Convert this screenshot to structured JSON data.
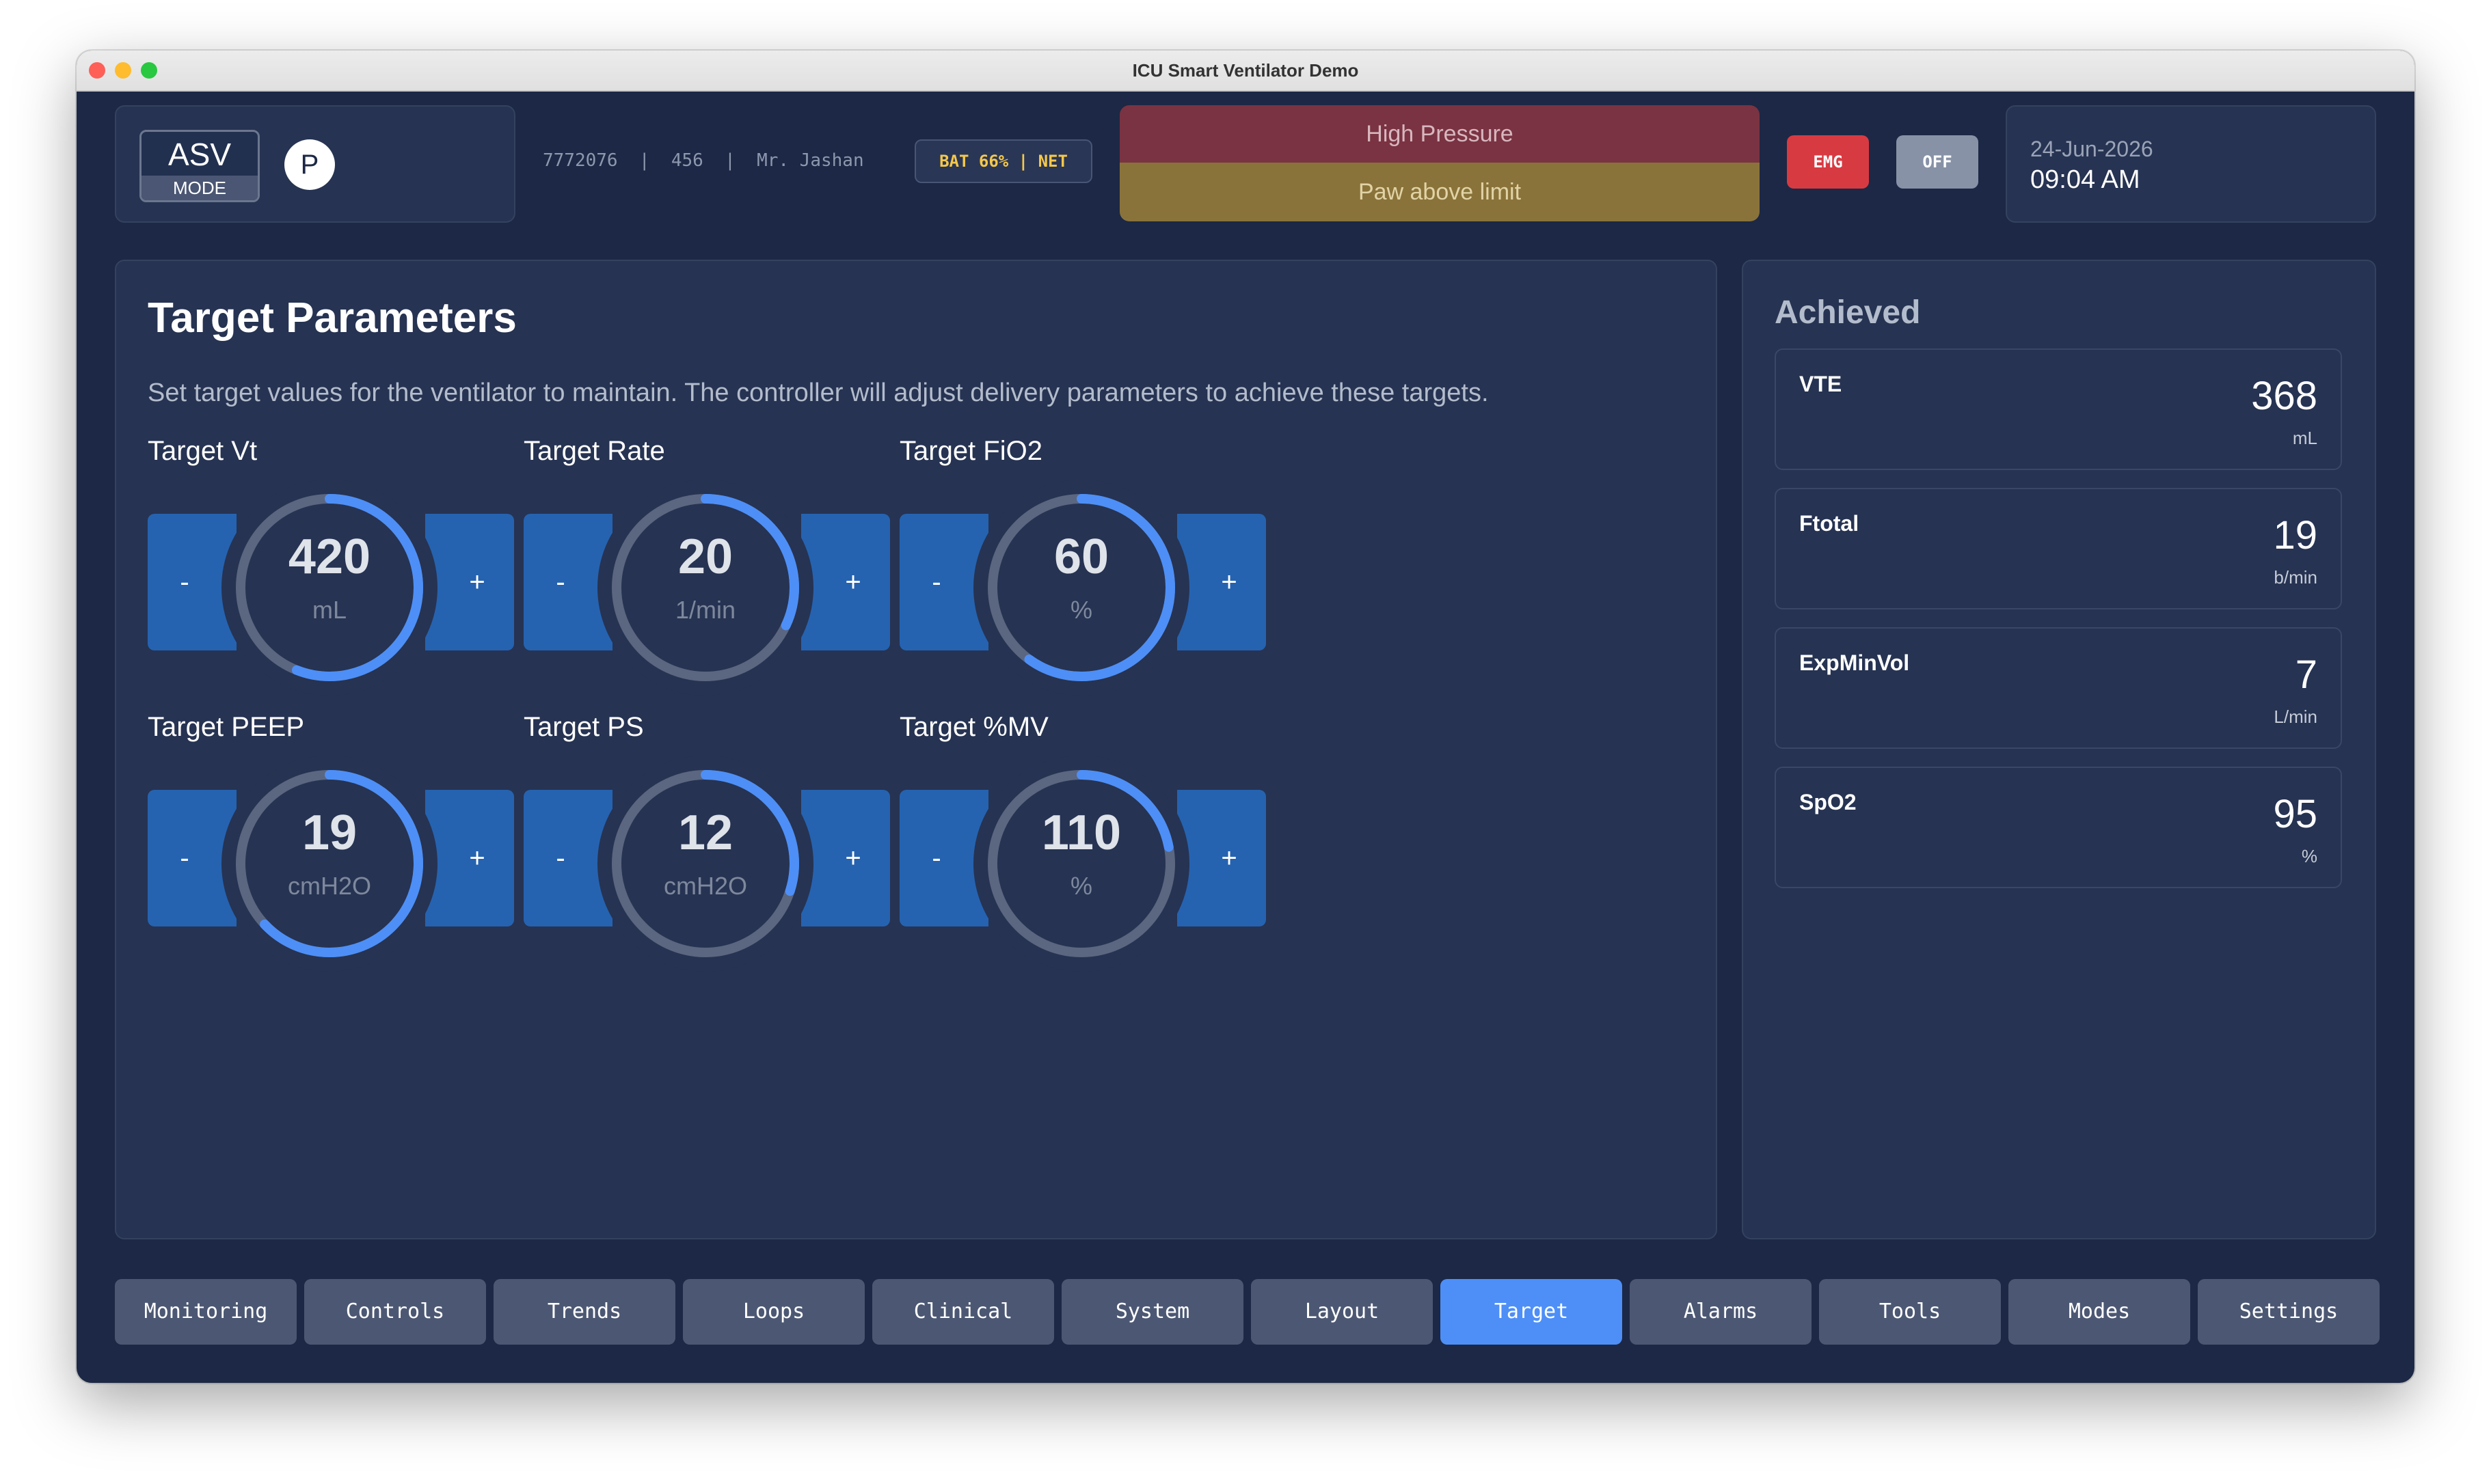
{
  "window": {
    "title": "ICU Smart Ventilator Demo"
  },
  "header": {
    "mode_value": "ASV",
    "mode_label": "MODE",
    "patient_badge": "P",
    "patient_info": "7772076  |  456  |  Mr. Jashan",
    "status": "BAT 66% | NET",
    "alarm_primary": "High Pressure",
    "alarm_secondary": "Paw above limit",
    "emg_label": "EMG",
    "off_label": "OFF",
    "date": "24-Jun-2026",
    "time": "09:04 AM"
  },
  "colors": {
    "accent": "#4d8ff7",
    "ring_track": "#5b6680",
    "stepper": "#2563b0",
    "alarm_high": "#7a3342",
    "alarm_medium": "#8a733a",
    "emg": "#d83a42"
  },
  "target": {
    "title": "Target Parameters",
    "description": "Set target values for the ventilator to maintain. The controller will adjust delivery parameters to achieve these targets.",
    "decrement_label": "-",
    "increment_label": "+",
    "controls": [
      {
        "label": "Target Vt",
        "value": "420",
        "unit": "mL",
        "fill": 0.56
      },
      {
        "label": "Target Rate",
        "value": "20",
        "unit": "1/min",
        "fill": 0.32
      },
      {
        "label": "Target FiO2",
        "value": "60",
        "unit": "%",
        "fill": 0.6
      },
      {
        "label": "Target PEEP",
        "value": "19",
        "unit": "cmH2O",
        "fill": 0.63
      },
      {
        "label": "Target PS",
        "value": "12",
        "unit": "cmH2O",
        "fill": 0.3
      },
      {
        "label": "Target %MV",
        "value": "110",
        "unit": "%",
        "fill": 0.22
      }
    ]
  },
  "achieved": {
    "title": "Achieved",
    "metrics": [
      {
        "name": "VTE",
        "value": "368",
        "unit": "mL"
      },
      {
        "name": "Ftotal",
        "value": "19",
        "unit": "b/min"
      },
      {
        "name": "ExpMinVol",
        "value": "7",
        "unit": "L/min"
      },
      {
        "name": "SpO2",
        "value": "95",
        "unit": "%"
      }
    ]
  },
  "nav": {
    "active_index": 7,
    "tabs": [
      "Monitoring",
      "Controls",
      "Trends",
      "Loops",
      "Clinical",
      "System",
      "Layout",
      "Target",
      "Alarms",
      "Tools",
      "Modes",
      "Settings"
    ]
  }
}
